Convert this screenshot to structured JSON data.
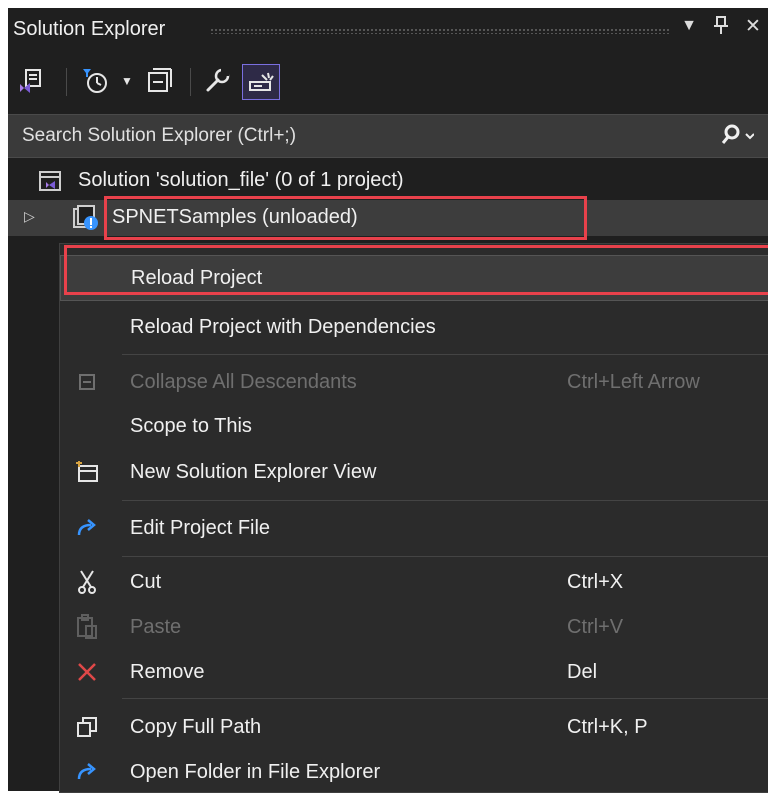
{
  "window": {
    "title": "Solution Explorer",
    "btn_dropdown": "▾",
    "btn_pin": "ꟷ",
    "btn_close": "✕"
  },
  "toolbar": {
    "icons": [
      "vs-switch-views-icon",
      "pending-changes-filter-icon",
      "dropdown-arrow-icon",
      "collapse-all-icon",
      "properties-wrench-icon",
      "preview-selected-items-icon"
    ]
  },
  "search": {
    "placeholder": "Search Solution Explorer (Ctrl+;)"
  },
  "tree": {
    "solution_label": "Solution 'solution_file' (0 of 1 project)",
    "project_label": "SPNETSamples (unloaded)"
  },
  "context_menu": {
    "items": [
      {
        "label": "Reload Project",
        "shortcut": "",
        "icon": "",
        "disabled": false,
        "selected": true
      },
      {
        "label": "Reload Project with Dependencies",
        "shortcut": "",
        "icon": "",
        "disabled": false
      },
      {
        "label": "Collapse All Descendants",
        "shortcut": "Ctrl+Left Arrow",
        "icon": "collapse-icon",
        "disabled": true
      },
      {
        "label": "Scope to This",
        "shortcut": "",
        "icon": "",
        "disabled": false
      },
      {
        "label": "New Solution Explorer View",
        "shortcut": "",
        "icon": "new-view-icon",
        "disabled": false
      },
      {
        "label": "Edit Project File",
        "shortcut": "",
        "icon": "redo-arrow-icon",
        "disabled": false
      },
      {
        "label": "Cut",
        "shortcut": "Ctrl+X",
        "icon": "scissors-icon",
        "disabled": false
      },
      {
        "label": "Paste",
        "shortcut": "Ctrl+V",
        "icon": "clipboard-icon",
        "disabled": true
      },
      {
        "label": "Remove",
        "shortcut": "Del",
        "icon": "red-x-icon",
        "disabled": false
      },
      {
        "label": "Copy Full Path",
        "shortcut": "Ctrl+K, P",
        "icon": "copy-icon",
        "disabled": false
      },
      {
        "label": "Open Folder in File Explorer",
        "shortcut": "",
        "icon": "redo-arrow-icon",
        "disabled": false
      }
    ]
  },
  "colors": {
    "highlight_border": "#e8414b",
    "accent_purple": "#7a6fe0",
    "accent_blue": "#3794ff",
    "remove_red": "#e04848"
  }
}
